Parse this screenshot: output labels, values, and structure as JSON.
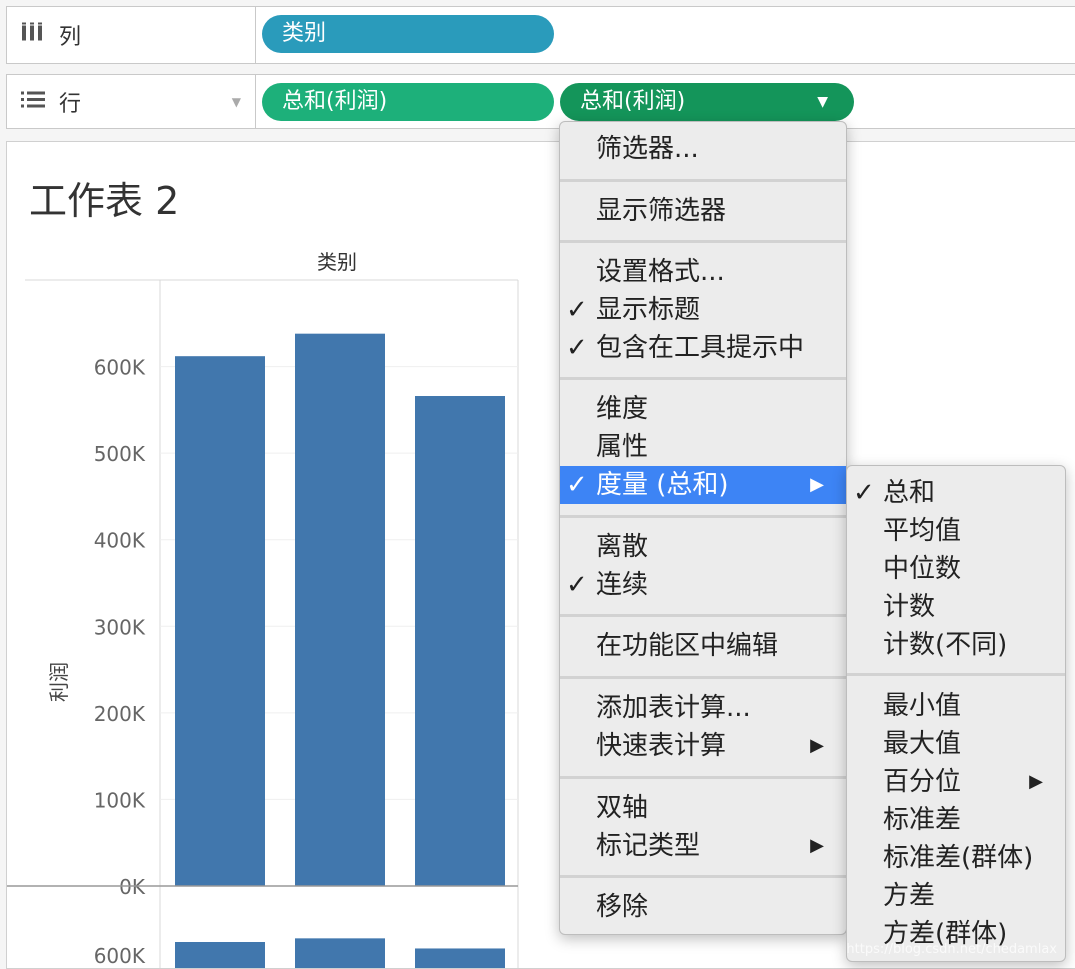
{
  "shelves": {
    "columns": {
      "icon": "columns-icon",
      "label": "列",
      "pill": "类别"
    },
    "rows": {
      "icon": "rows-icon",
      "label": "行",
      "pills": [
        "总和(利润)",
        "总和(利润)"
      ]
    }
  },
  "sheet": {
    "title": "工作表 2"
  },
  "chart_data": {
    "type": "bar",
    "column_header": "类别",
    "ylabel": "利润",
    "categories": [
      "",
      "",
      ""
    ],
    "values": [
      612000,
      638000,
      566000
    ],
    "y_ticks": [
      "600K",
      "500K",
      "400K",
      "300K",
      "200K",
      "100K",
      "0K"
    ],
    "ylim": [
      0,
      700000
    ],
    "bar_color": "#4177ad",
    "second_pane_tick": "600K"
  },
  "menu": {
    "items": [
      {
        "label": "筛选器...",
        "checked": false,
        "submenu": false
      },
      {
        "label": "显示筛选器",
        "checked": false,
        "submenu": false
      },
      {
        "label": "设置格式...",
        "checked": false,
        "submenu": false
      },
      {
        "label": "显示标题",
        "checked": true,
        "submenu": false
      },
      {
        "label": "包含在工具提示中",
        "checked": true,
        "submenu": false
      },
      {
        "label": "维度",
        "checked": false,
        "submenu": false
      },
      {
        "label": "属性",
        "checked": false,
        "submenu": false
      },
      {
        "label": "度量 (总和)",
        "checked": true,
        "submenu": true,
        "active": true
      },
      {
        "label": "离散",
        "checked": false,
        "submenu": false
      },
      {
        "label": "连续",
        "checked": true,
        "submenu": false
      },
      {
        "label": "在功能区中编辑",
        "checked": false,
        "submenu": false
      },
      {
        "label": "添加表计算...",
        "checked": false,
        "submenu": false
      },
      {
        "label": "快速表计算",
        "checked": false,
        "submenu": true
      },
      {
        "label": "双轴",
        "checked": false,
        "submenu": false
      },
      {
        "label": "标记类型",
        "checked": false,
        "submenu": true
      },
      {
        "label": "移除",
        "checked": false,
        "submenu": false
      }
    ]
  },
  "submenu": {
    "items": [
      {
        "label": "总和",
        "checked": true
      },
      {
        "label": "平均值",
        "checked": false
      },
      {
        "label": "中位数",
        "checked": false
      },
      {
        "label": "计数",
        "checked": false
      },
      {
        "label": "计数(不同)",
        "checked": false
      },
      {
        "label": "最小值",
        "checked": false
      },
      {
        "label": "最大值",
        "checked": false
      },
      {
        "label": "百分位",
        "checked": false,
        "submenu": true
      },
      {
        "label": "标准差",
        "checked": false
      },
      {
        "label": "标准差(群体)",
        "checked": false
      },
      {
        "label": "方差",
        "checked": false
      },
      {
        "label": "方差(群体)",
        "checked": false
      }
    ]
  },
  "glyphs": {
    "check": "✓",
    "arrow": "▶",
    "caret": "▼"
  },
  "watermark": "https://blog.csdn.net/chedamlax"
}
